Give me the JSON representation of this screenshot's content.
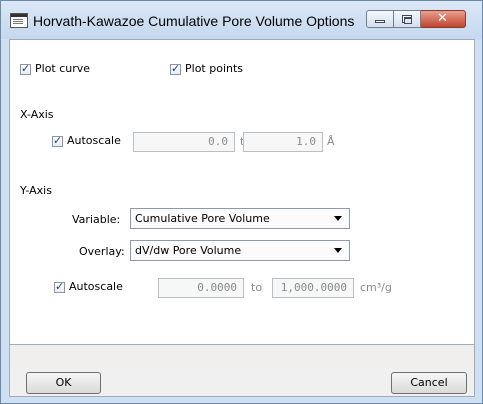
{
  "window": {
    "title": "Horvath-Kawazoe Cumulative Pore Volume Options"
  },
  "options": {
    "plot_curve": {
      "label": "Plot curve",
      "checked": true
    },
    "plot_points": {
      "label": "Plot points",
      "checked": true
    }
  },
  "x_axis": {
    "section_label": "X-Axis",
    "autoscale": {
      "label": "Autoscale",
      "checked": true
    },
    "min": "0.0",
    "to_label": "to",
    "max": "1.0",
    "unit": "Å"
  },
  "y_axis": {
    "section_label": "Y-Axis",
    "variable_label": "Variable:",
    "variable_value": "Cumulative Pore Volume",
    "overlay_label": "Overlay:",
    "overlay_value": "dV/dw Pore Volume",
    "autoscale": {
      "label": "Autoscale",
      "checked": true
    },
    "min": "0.0000",
    "to_label": "to",
    "max": "1,000.0000",
    "unit": "cm³/g"
  },
  "buttons": {
    "ok": "OK",
    "cancel": "Cancel"
  },
  "colors": {
    "close_button": "#c0442e",
    "title_bar": "#c4d8ee"
  }
}
